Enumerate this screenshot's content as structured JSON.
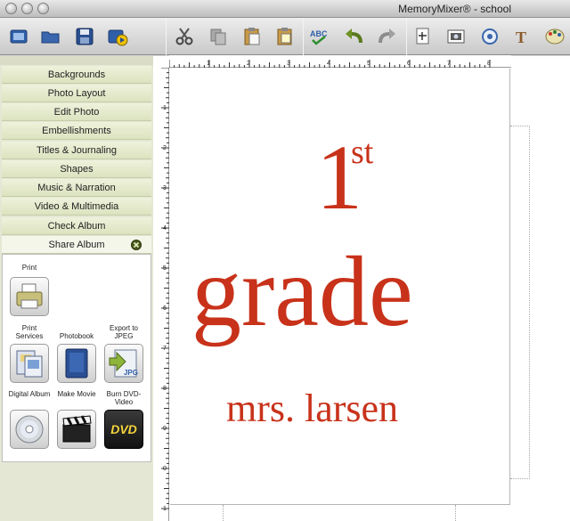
{
  "window": {
    "title": "MemoryMixer® - school"
  },
  "toolbar": {
    "groups": [
      [
        "new-page-icon",
        "open-folder-icon",
        "save-icon",
        "preview-icon"
      ],
      [
        "scissors-icon",
        "copy-icon",
        "paste-icon",
        "paste-special-icon"
      ],
      [
        "spell-check-icon",
        "undo-icon",
        "redo-icon"
      ],
      [
        "add-page-icon",
        "add-photo-icon",
        "embellishment-icon",
        "text-icon",
        "color-palette-icon"
      ]
    ]
  },
  "sidebar": {
    "items": [
      {
        "label": "Backgrounds"
      },
      {
        "label": "Photo Layout"
      },
      {
        "label": "Edit Photo"
      },
      {
        "label": "Embellishments"
      },
      {
        "label": "Titles & Journaling"
      },
      {
        "label": "Shapes"
      },
      {
        "label": "Music & Narration"
      },
      {
        "label": "Video & Multimedia"
      },
      {
        "label": "Check Album"
      },
      {
        "label": "Share Album"
      }
    ],
    "active_item": "Share Album"
  },
  "share_panel": {
    "print": {
      "label": "Print"
    },
    "print_services": {
      "label": "Print Services"
    },
    "photobook": {
      "label": "Photobook"
    },
    "export_jpeg": {
      "label": "Export to JPEG",
      "icon_text": "JPG"
    },
    "digital_album": {
      "label": "Digital Album"
    },
    "make_movie": {
      "label": "Make Movie"
    },
    "burn_dvd": {
      "label": "Burn DVD-Video",
      "icon_text": "DVD"
    }
  },
  "rulers": {
    "horizontal": [
      "1",
      "2",
      "3",
      "4",
      "5",
      "6",
      "7",
      "8"
    ],
    "vertical": [
      "1",
      "2",
      "3",
      "4",
      "5",
      "6",
      "7",
      "8",
      "9",
      "0",
      "1"
    ]
  },
  "page_text": {
    "number": "1",
    "ordinal": "st",
    "grade": "grade",
    "teacher": "mrs. larsen"
  },
  "colors": {
    "page_text": "#c8321a",
    "sidebar_bg": "#e4e7d4",
    "nav_item": "#dce3bf"
  }
}
